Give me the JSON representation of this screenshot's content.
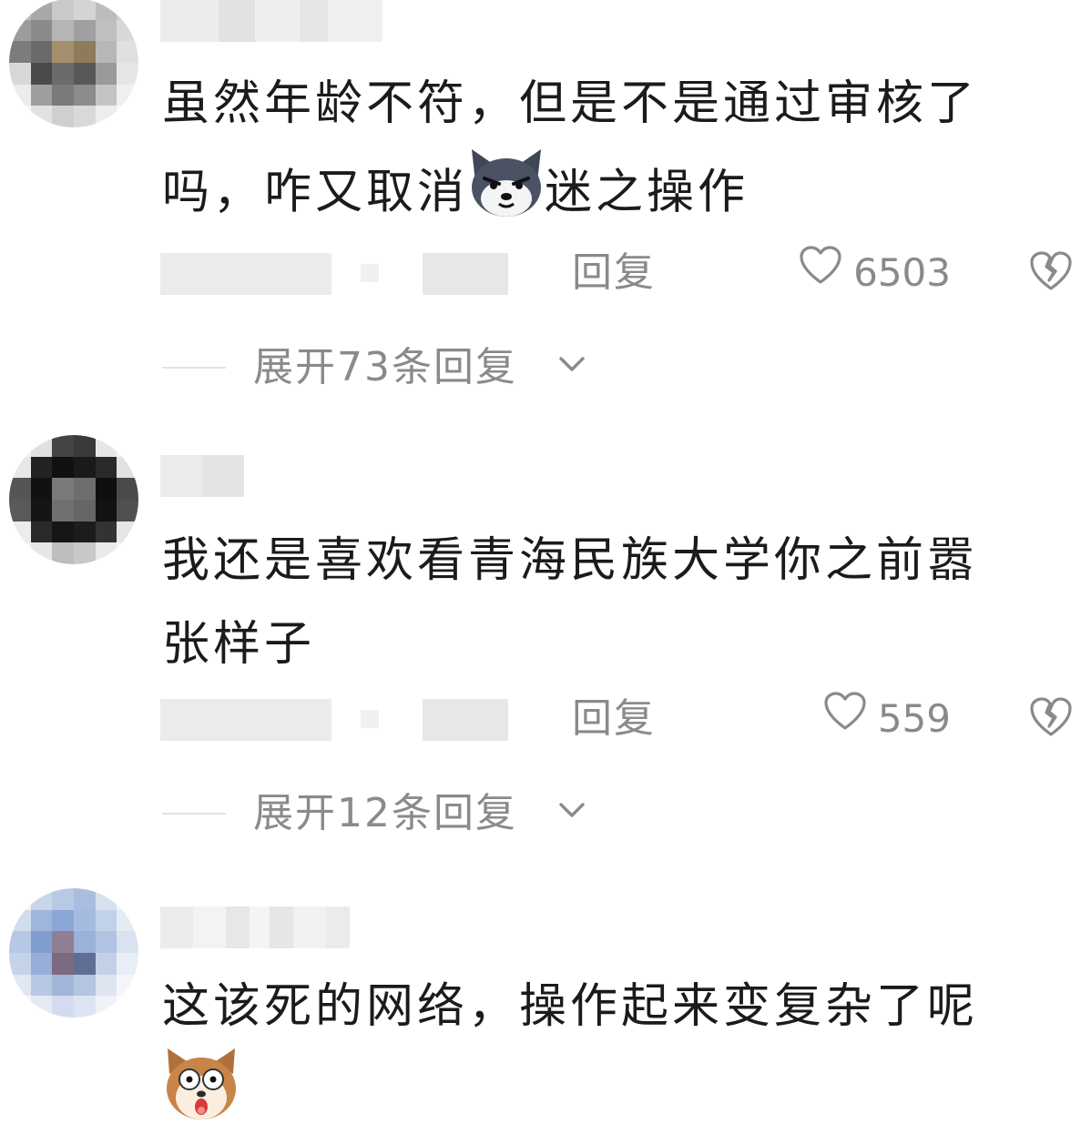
{
  "comments": [
    {
      "text_line1": "虽然年龄不符，但是不是通过审核了",
      "text_line2_before": "吗，咋又取消",
      "text_line2_after": "迷之操作",
      "inline_emoji": "smirking-husky-emoji",
      "reply_label": "回复",
      "like_count": "6503",
      "expand_label": "展开73条回复"
    },
    {
      "text_line1": "我还是喜欢看青海民族大学你之前嚣",
      "text_line2": "张样子",
      "reply_label": "回复",
      "like_count": "559",
      "expand_label": "展开12条回复"
    },
    {
      "text_line1": "这该死的网络，操作起来变复杂了呢",
      "trailing_emoji": "shocked-dog-emoji"
    }
  ],
  "icons": {
    "like": "heart-outline-icon",
    "dislike": "broken-heart-icon",
    "expand": "chevron-down-icon"
  },
  "colors": {
    "text": "#1b1b1b",
    "secondary": "#8a8a8a",
    "background": "#ffffff"
  }
}
